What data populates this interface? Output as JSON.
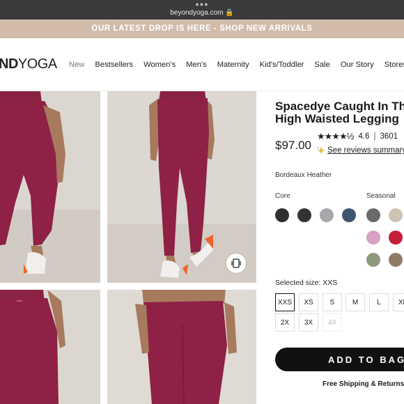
{
  "browser": {
    "url": "beyondyoga.com"
  },
  "promo": {
    "text": "OUR LATEST DROP IS HERE - SHOP NEW ARRIVALS"
  },
  "header": {
    "logo_bold": "ND",
    "logo_light": "YOGA",
    "nav": [
      "New",
      "Bestsellers",
      "Women's",
      "Men's",
      "Maternity",
      "Kid's/Toddler",
      "Sale",
      "Our Story",
      "Stores"
    ]
  },
  "product": {
    "title_line1": "Spacedye Caught In Th",
    "title_line2": "High Waisted Legging",
    "price": "$97.00",
    "rating_stars": "★★★★½",
    "rating": "4.6",
    "review_count": "3601",
    "reviews_link": "See reviews summary",
    "color_name": "Bordeaux Heather",
    "core_label": "Core",
    "seasonal_label": "Seasonal",
    "core_swatches": [
      "#2e2f31",
      "#333333",
      "#a7a8ab",
      "#3f5670"
    ],
    "seasonal_swatches": [
      "#6a6b69",
      "#cfc3b3",
      "#d8a0c2",
      "#c3203a",
      "#8e9a7d",
      "#8f7b66"
    ],
    "selected_size_label": "Selected size: XXS",
    "sizes_row1": [
      "XXS",
      "XS",
      "S",
      "M",
      "L",
      "XL"
    ],
    "sizes_row2": [
      "2X",
      "3X",
      "4X"
    ],
    "selected_size": "XXS",
    "unavailable_sizes": [
      "4X"
    ],
    "add_to_bag": "ADD TO BAG",
    "shipping": "Free Shipping & Returns"
  },
  "colors": {
    "promo_bg": "#d1bcab",
    "legging": "#8e2145",
    "button": "#111111"
  }
}
